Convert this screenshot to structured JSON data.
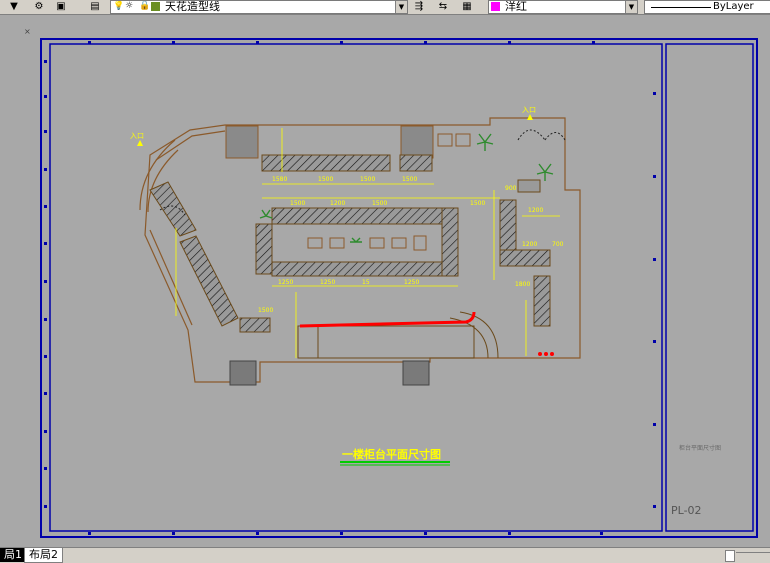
{
  "toolbar": {
    "layer_name": "天花造型线",
    "color_name": "洋红",
    "linetype": "ByLayer",
    "colors": {
      "layer_swatch": "#6b8e23",
      "magenta": "#ff00ff"
    }
  },
  "drawing": {
    "title": "一楼柜台平面尺寸图",
    "entrance_left": "入口",
    "entrance_right": "入口",
    "sheet_code": "PL-02",
    "titleblock_caption": "柜台平面尺寸图",
    "dims": {
      "d1": "1580",
      "d2": "1500",
      "d3": "1500",
      "d4": "1500",
      "d5": "1500",
      "d6": "1200",
      "d7": "1500",
      "d8": "1500",
      "d9": "900",
      "d10": "1200",
      "d11": "700",
      "d12": "1200"
    },
    "colors": {
      "frame": "#0000aa",
      "wall": "#8b5a2b",
      "dimension": "#ffff00",
      "rail": "#ff0000",
      "title_underline": "#00cc00",
      "background": "#a8a8a8"
    }
  },
  "layout_tabs": {
    "active": "局1",
    "second": "布局2"
  }
}
